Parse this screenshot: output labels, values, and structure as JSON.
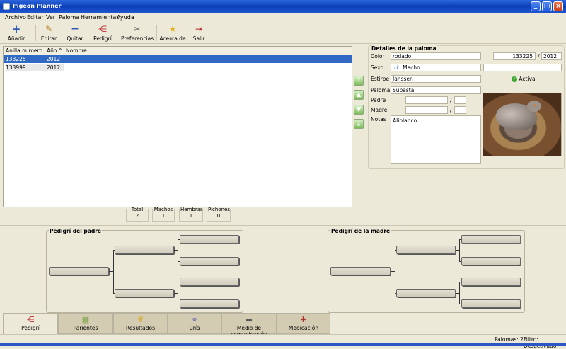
{
  "window": {
    "title": "Pigeon Planner"
  },
  "menu": [
    "Archivo",
    "Editar",
    "Ver",
    "Paloma",
    "Herramientas",
    "Ayuda"
  ],
  "toolbar": {
    "add": "Añadir",
    "edit": "Editar",
    "remove": "Quitar",
    "pedigree": "Pedigrí",
    "preferences": "Preferencias",
    "about": "Acerca de",
    "quit": "Salir"
  },
  "list": {
    "columns": [
      "Anilla numero",
      "Año",
      "Nombre"
    ],
    "sort_indicator": "^",
    "rows": [
      {
        "ring": "133225",
        "year": "2012",
        "name": ""
      },
      {
        "ring": "133999",
        "year": "2012",
        "name": ""
      }
    ]
  },
  "counts": [
    {
      "label": "Total",
      "value": "2"
    },
    {
      "label": "Machos",
      "value": "1"
    },
    {
      "label": "Hembras",
      "value": "1"
    },
    {
      "label": "Pichones",
      "value": "0"
    }
  ],
  "details": {
    "title": "Detalles de la paloma",
    "color_label": "Color",
    "color_value": "rodado",
    "ring_value": "133225",
    "year_sep": "/",
    "year_value": "2012",
    "sex_label": "Sexo",
    "sex_symbol": "♂",
    "sex_value": "Macho",
    "strain_label": "Estirpe",
    "strain_value": "Janssen",
    "status_value": "Activa",
    "loft_label": "Palomar",
    "loft_value": "Subasta",
    "father_label": "Padre",
    "mother_label": "Madre",
    "parent_sep": "/",
    "notes_label": "Notas",
    "notes_value": "Aliblanco"
  },
  "pedigree": {
    "father_title": "Pedigrí del padre",
    "mother_title": "Pedigrí de la madre"
  },
  "tabs": [
    "Pedigrí",
    "Parientes",
    "Resultados",
    "Cría",
    "Medio de comunicación",
    "Medicación"
  ],
  "status": {
    "pigeons": "Palomas: 2",
    "filter": "Filtro: Desactivado"
  },
  "colors": {
    "selection": "#316ac5",
    "title_bar": "#0a3fb8",
    "active_icon": "#3aa52c"
  }
}
